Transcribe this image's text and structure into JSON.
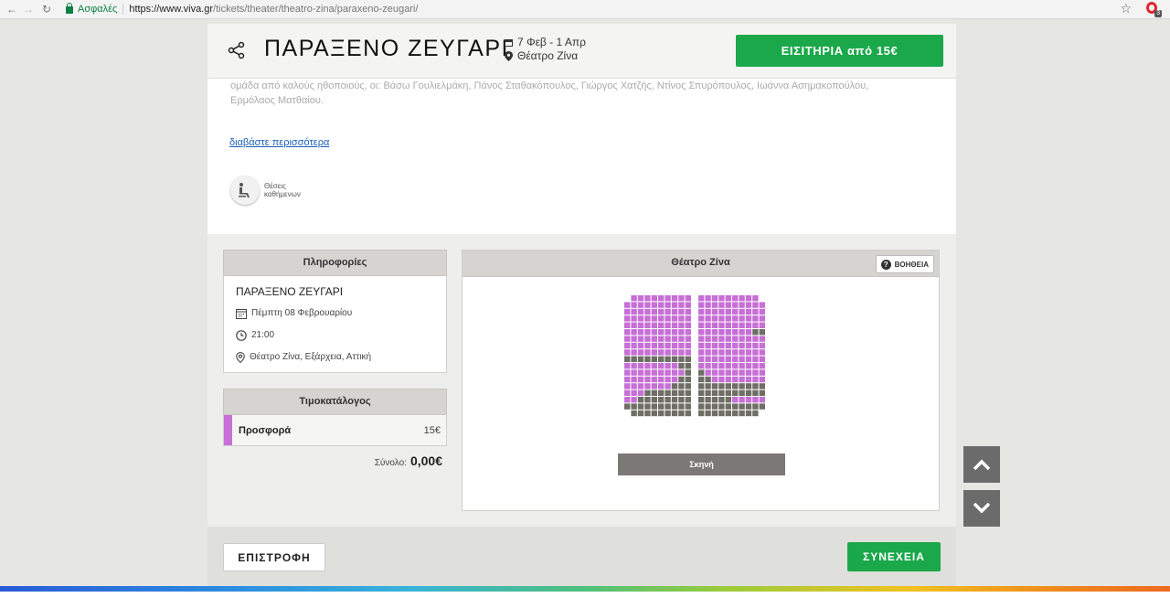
{
  "browser": {
    "secure_label": "Ασφαλές",
    "url_host": "https://www.viva.gr",
    "url_path": "/tickets/theater/theatro-zina/paraxeno-zeugari/",
    "extension_badge": "3"
  },
  "header": {
    "title": "ΠΑΡΑΞΕΝΟ ΖΕΥΓΑΡΙ",
    "dates": "7 Φεβ - 1 Απρ",
    "venue": "Θέατρο Ζίνα",
    "tickets_button": "ΕΙΣΙΤΗΡΙΑ από 15€"
  },
  "description": {
    "line1": "ομάδα από καλούς ηθοποιούς, οι: Βάσω Γουλιελμάκη, Πάνος Σταθακόπουλος, Γιώργος Χατζής, Ντίνος Σπυρόπουλος, Ιωάννα Ασημακοπούλου,",
    "line2": "Ερμόλαος Ματθαίου.",
    "read_more": "διαβάστε περισσότερα",
    "badge_line1": "Θέσεις",
    "badge_line2": "καθήμενων"
  },
  "info": {
    "heading": "Πληροφορίες",
    "title": "ΠΑΡΑΞΕΝΟ ΖΕΥΓΑΡΙ",
    "date": "Πέμπτη 08 Φεβρουαρίου",
    "time": "21:00",
    "location": "Θέατρο Ζίνα, Εξάρχεια, Αττική"
  },
  "pricelist": {
    "heading": "Τιμοκατάλογος",
    "items": [
      {
        "name": "Προσφορά",
        "price": "15€",
        "color": "#c76fd6"
      }
    ],
    "total_label": "Σύνολο:",
    "total_value": "0,00€"
  },
  "seatmap": {
    "heading": "Θέατρο Ζίνα",
    "help_label": "ΒΟΗΘΕΙΑ",
    "stage_label": "Σκηνή",
    "available_color": "#c76fd6",
    "unavailable_color": "#6e6e66",
    "left_block": [
      "_DDDDDDDDD",
      "DDDDDDDDDD",
      "DDDDDDDDDD",
      "DDDDDDDDDD",
      "DDDDDDDDDD",
      "DDDDDDDDDD",
      "DDDDDDDDDD",
      "DDDDDDDDDD",
      "DDDDDDDDDD",
      "XXXXXXXXXX",
      "DDDDDDDDXX",
      "DDDDDDDDDX",
      "DDDDDDDDXX",
      "DDDDDDDXXX",
      "DDDXXXXXXX",
      "DDXXXXXXXX",
      "XXXXXXXXXX",
      "_XXXXXXXXX"
    ],
    "right_block": [
      "DDDDDDDDD_",
      "DDDDDDDDDD",
      "DDDDDDDDDD",
      "DDDDDDDDDD",
      "DDDDDDDDDD",
      "DDDDDDDDXX",
      "DDDDDDDDDD",
      "DDDDDDDDDD",
      "DDDDDDDDDD",
      "DDDDDDDDDD",
      "DDDDDDDDDD",
      "XDDDDDDDDD",
      "XXDDDDDDDD",
      "XXXXXXXXXX",
      "XXXXXXXXXX",
      "XXXXXDDDDD",
      "XXXXXXXXXX",
      "XXXXXXXXX_"
    ]
  },
  "footer": {
    "back": "ΕΠΙΣΤΡΟΦΗ",
    "next": "ΣΥΝΕΧΕΙΑ"
  }
}
